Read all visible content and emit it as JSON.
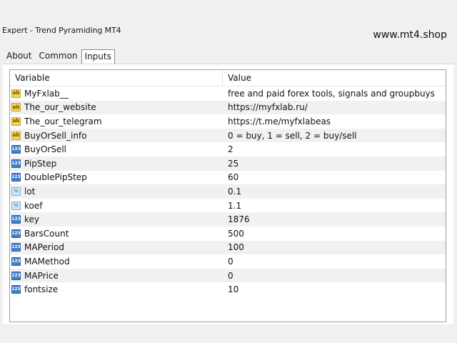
{
  "window": {
    "title": "Expert - Trend Pyramiding MT4",
    "watermark": "www.mt4.shop"
  },
  "tabs": [
    {
      "label": "About",
      "active": false
    },
    {
      "label": "Common",
      "active": false
    },
    {
      "label": "Inputs",
      "active": true
    }
  ],
  "grid": {
    "headers": {
      "variable": "Variable",
      "value": "Value"
    },
    "rows": [
      {
        "type": "string",
        "icon": "ab",
        "variable": "MyFxlab__",
        "value": "free and paid forex tools, signals and groupbuys"
      },
      {
        "type": "string",
        "icon": "ab",
        "variable": "The_our_website",
        "value": "https://myfxlab.ru/"
      },
      {
        "type": "string",
        "icon": "ab",
        "variable": "The_our_telegram",
        "value": "https://t.me/myfxlabeas"
      },
      {
        "type": "string",
        "icon": "ab",
        "variable": "BuyOrSell_info",
        "value": "0 = buy, 1 = sell, 2 = buy/sell"
      },
      {
        "type": "int",
        "icon": "123",
        "variable": "BuyOrSell",
        "value": "2"
      },
      {
        "type": "int",
        "icon": "123",
        "variable": "PipStep",
        "value": "25"
      },
      {
        "type": "int",
        "icon": "123",
        "variable": "DoublePipStep",
        "value": "60"
      },
      {
        "type": "double",
        "icon": "½",
        "variable": "lot",
        "value": "0.1"
      },
      {
        "type": "double",
        "icon": "½",
        "variable": "koef",
        "value": "1.1"
      },
      {
        "type": "int",
        "icon": "123",
        "variable": "key",
        "value": "1876"
      },
      {
        "type": "int",
        "icon": "123",
        "variable": "BarsCount",
        "value": "500"
      },
      {
        "type": "int",
        "icon": "123",
        "variable": "MAPeriod",
        "value": "100"
      },
      {
        "type": "int",
        "icon": "123",
        "variable": "MAMethod",
        "value": "0"
      },
      {
        "type": "int",
        "icon": "123",
        "variable": "MAPrice",
        "value": "0"
      },
      {
        "type": "int",
        "icon": "123",
        "variable": "fontsize",
        "value": "10"
      }
    ]
  },
  "colors": {
    "string_icon": "#f3d35b",
    "int_icon": "#3f7fce",
    "double_icon": "#cfe6f7",
    "alt_row": "#f1f1f1"
  }
}
